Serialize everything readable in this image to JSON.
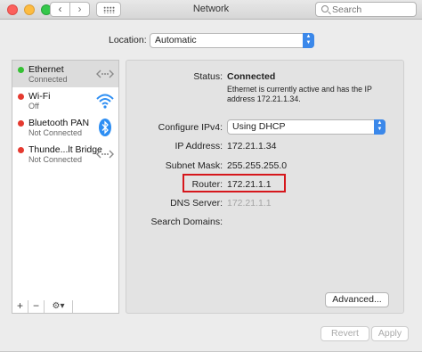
{
  "window": {
    "title": "Network"
  },
  "search": {
    "placeholder": "Search"
  },
  "location": {
    "label": "Location:",
    "value": "Automatic"
  },
  "services": [
    {
      "name": "Ethernet",
      "status": "Connected",
      "status_color": "#35c133",
      "icon": "ethernet-icon"
    },
    {
      "name": "Wi-Fi",
      "status": "Off",
      "status_color": "#e53a30",
      "icon": "wifi-icon"
    },
    {
      "name": "Bluetooth PAN",
      "status": "Not Connected",
      "status_color": "#e53a30",
      "icon": "bluetooth-icon"
    },
    {
      "name": "Thunde...lt Bridge",
      "status": "Not Connected",
      "status_color": "#e53a30",
      "icon": "thunderbolt-bridge-icon"
    }
  ],
  "sidebar_footer": {
    "add": "+",
    "remove": "−",
    "gear": "⚙▾"
  },
  "details": {
    "status_label": "Status:",
    "status_value": "Connected",
    "status_desc": "Ethernet is currently active and has the IP address 172.21.1.34.",
    "configure_label": "Configure IPv4:",
    "configure_value": "Using DHCP",
    "ip_label": "IP Address:",
    "ip_value": "172.21.1.34",
    "subnet_label": "Subnet Mask:",
    "subnet_value": "255.255.255.0",
    "router_label": "Router:",
    "router_value": "172.21.1.1",
    "dns_label": "DNS Server:",
    "dns_value": "172.21.1.1",
    "search_domains_label": "Search Domains:"
  },
  "buttons": {
    "advanced": "Advanced...",
    "help": "?",
    "revert": "Revert",
    "apply": "Apply"
  },
  "colors": {
    "accent": "#3b88ea",
    "highlight_box": "#d6171c",
    "connected": "#35c133",
    "disconnected": "#e53a30"
  }
}
